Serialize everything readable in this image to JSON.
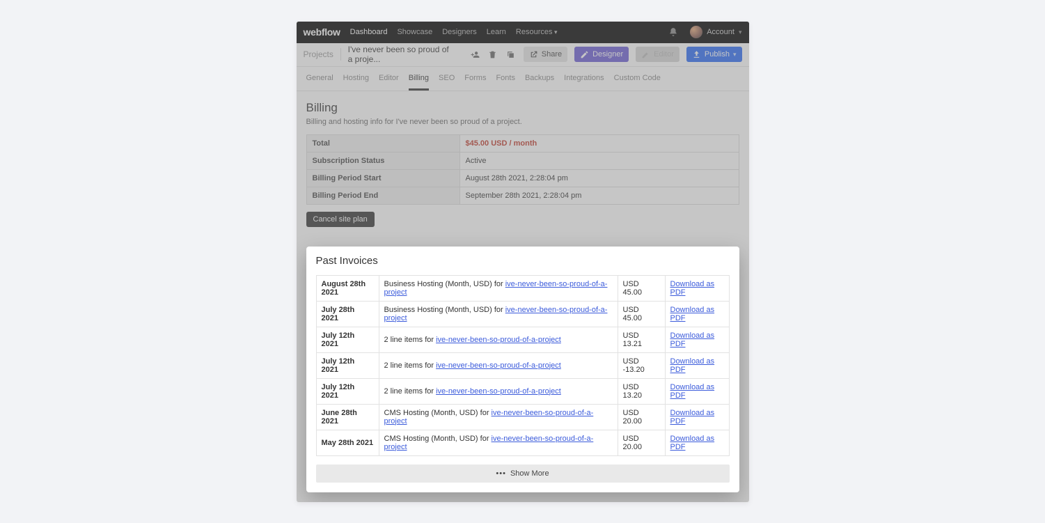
{
  "brand": "webflow",
  "topnav": {
    "items": [
      "Dashboard",
      "Showcase",
      "Designers",
      "Learn",
      "Resources"
    ],
    "active_index": 0,
    "account_label": "Account"
  },
  "projectbar": {
    "crumb": "Projects",
    "title": "I've never been so proud of a proje...",
    "share": "Share",
    "designer": "Designer",
    "editor_disabled": "Editor",
    "publish": "Publish"
  },
  "tabs": {
    "items": [
      "General",
      "Hosting",
      "Editor",
      "Billing",
      "SEO",
      "Forms",
      "Fonts",
      "Backups",
      "Integrations",
      "Custom Code"
    ],
    "active_index": 3
  },
  "billing": {
    "heading": "Billing",
    "subtitle": "Billing and hosting info for I've never been so proud of a project.",
    "rows": [
      {
        "label": "Total",
        "value": "$45.00 USD / month",
        "is_total": true
      },
      {
        "label": "Subscription Status",
        "value": "Active"
      },
      {
        "label": "Billing Period Start",
        "value": "August 28th 2021, 2:28:04 pm"
      },
      {
        "label": "Billing Period End",
        "value": "September 28th 2021, 2:28:04 pm"
      }
    ],
    "cancel_label": "Cancel site plan"
  },
  "past_invoices": {
    "heading": "Past Invoices",
    "download_label": "Download as PDF",
    "project_link_text": "ive-never-been-so-proud-of-a-project",
    "show_more": "Show More",
    "rows": [
      {
        "date": "August 28th 2021",
        "desc_prefix": "Business Hosting (Month, USD) for ",
        "amount": "USD 45.00"
      },
      {
        "date": "July 28th 2021",
        "desc_prefix": "Business Hosting (Month, USD) for ",
        "amount": "USD 45.00"
      },
      {
        "date": "July 12th 2021",
        "desc_prefix": "2 line items for ",
        "amount": "USD 13.21"
      },
      {
        "date": "July 12th 2021",
        "desc_prefix": "2 line items for ",
        "amount": "USD -13.20"
      },
      {
        "date": "July 12th 2021",
        "desc_prefix": "2 line items for ",
        "amount": "USD 13.20"
      },
      {
        "date": "June 28th 2021",
        "desc_prefix": "CMS Hosting (Month, USD) for ",
        "amount": "USD 20.00"
      },
      {
        "date": "May 28th 2021",
        "desc_prefix": "CMS Hosting (Month, USD) for ",
        "amount": "USD 20.00"
      }
    ]
  }
}
